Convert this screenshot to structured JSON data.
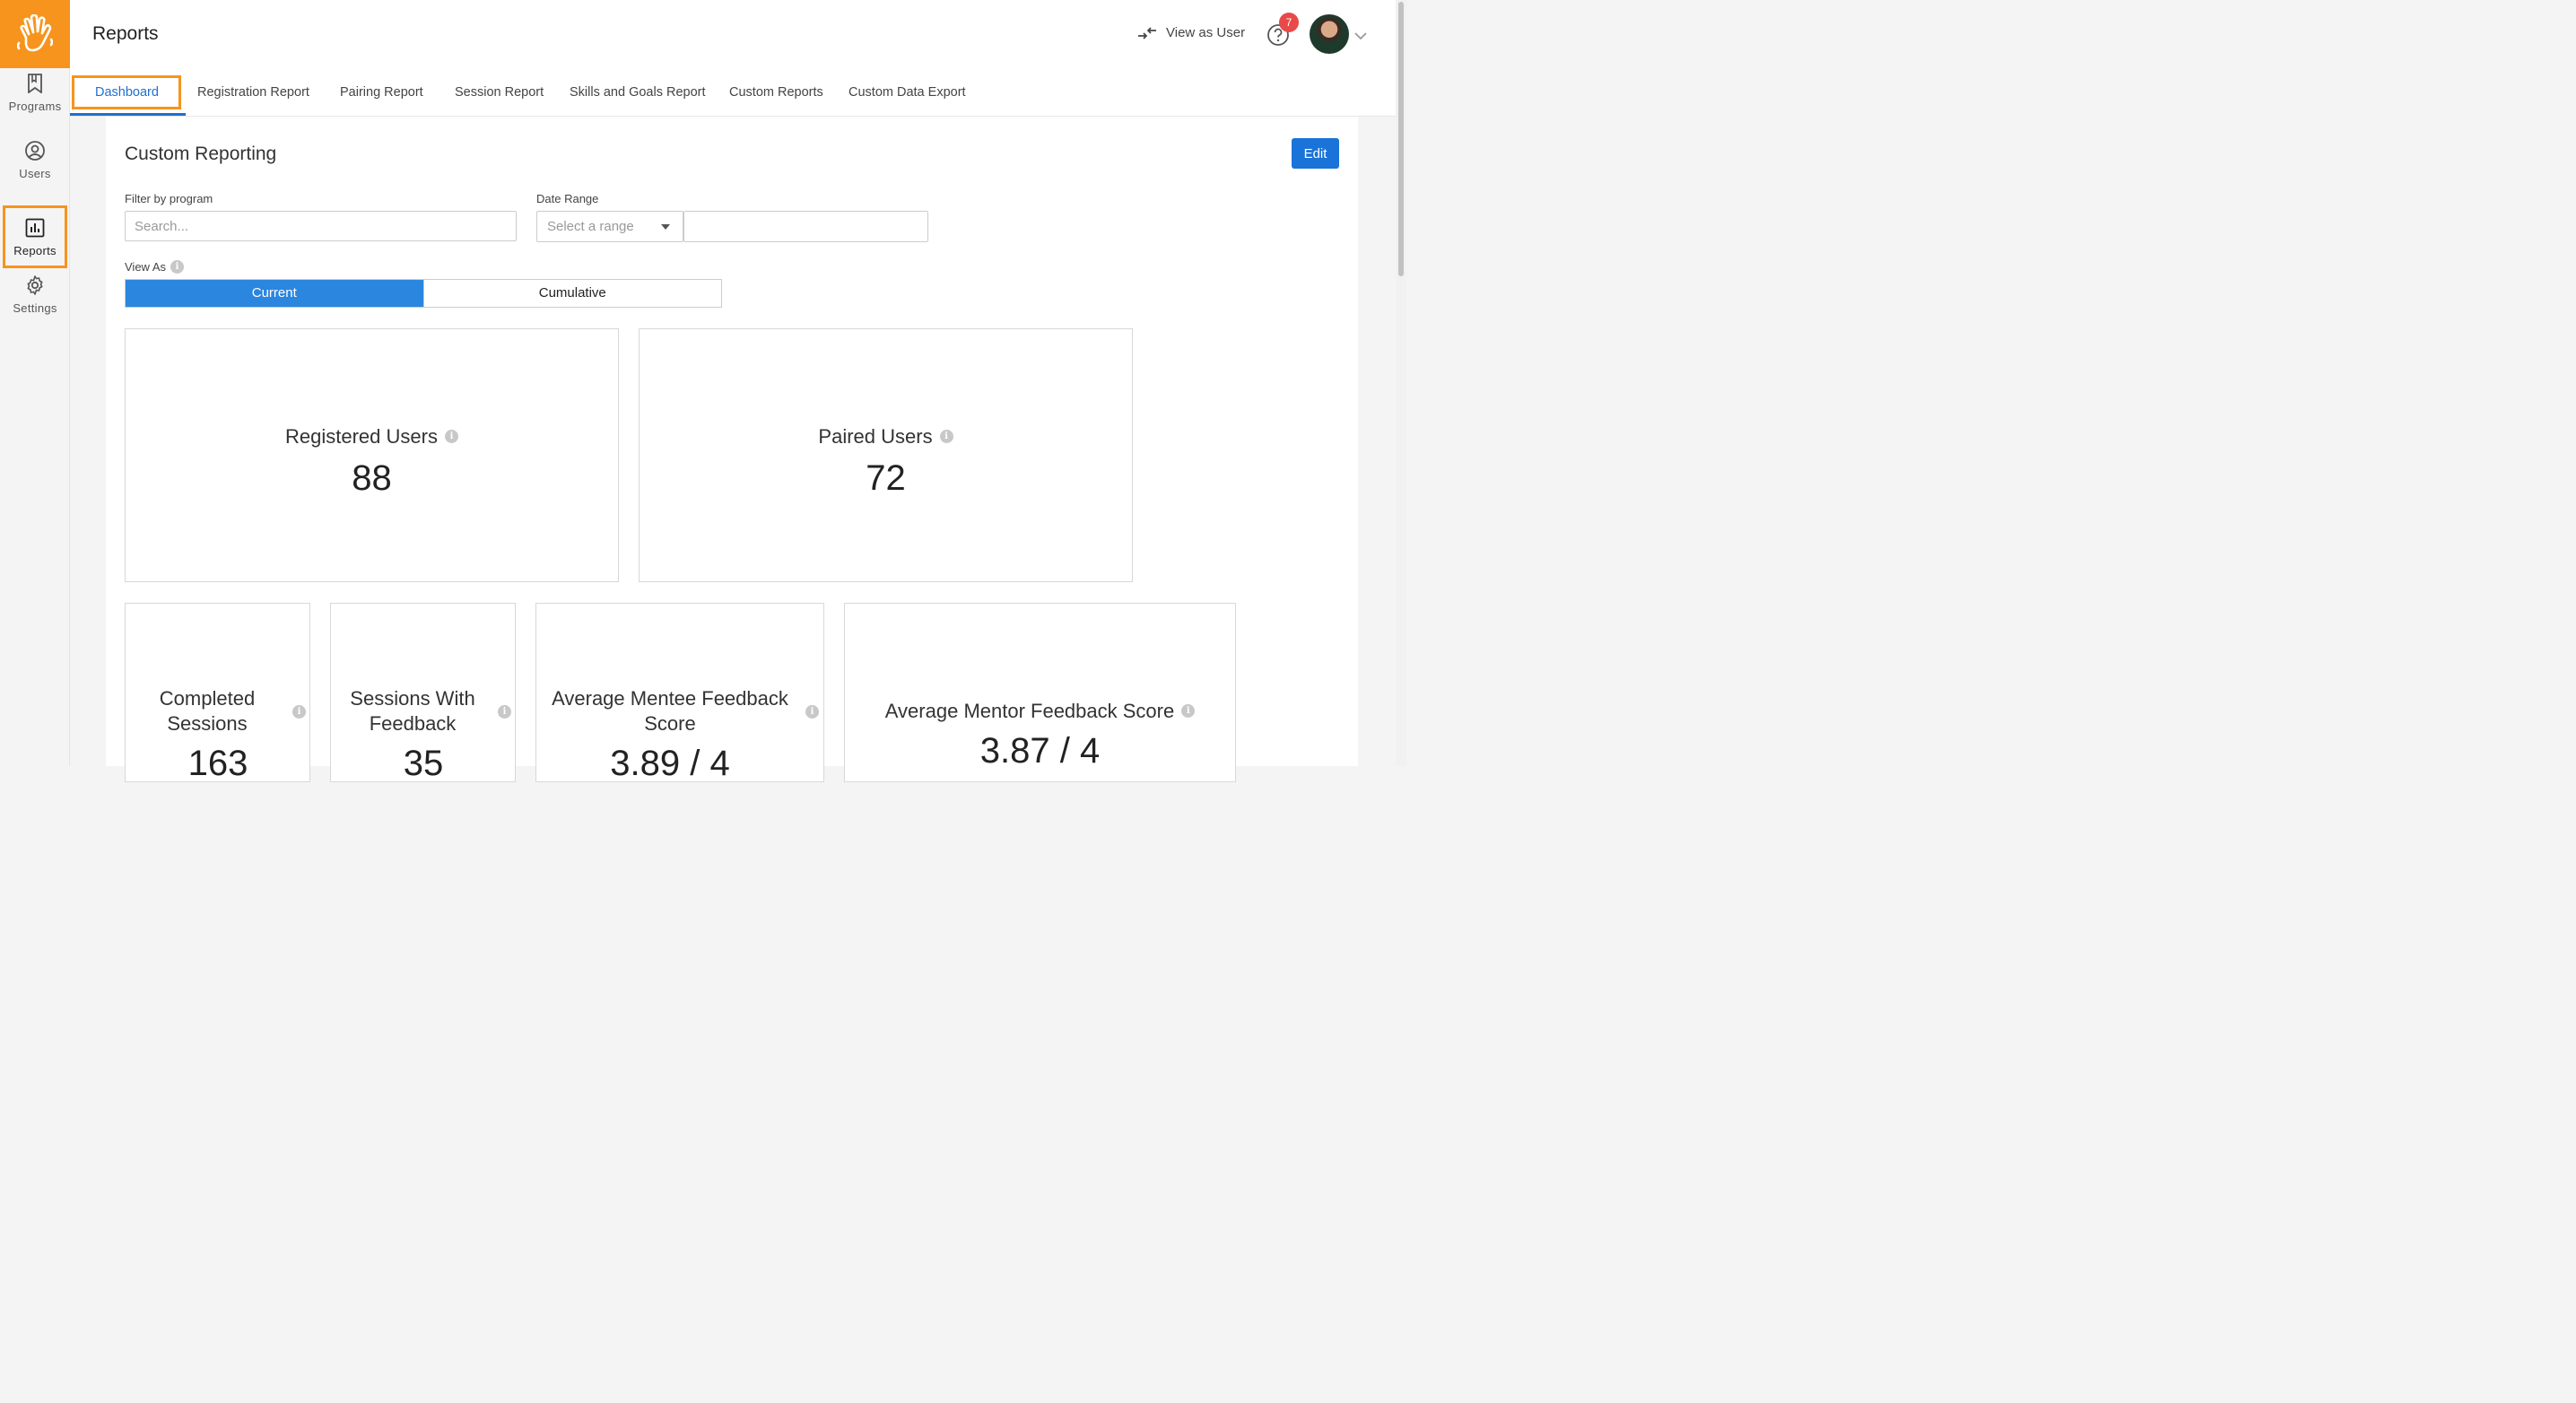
{
  "sidebar": {
    "logo": "hand-logo",
    "items": [
      {
        "label": "Programs",
        "icon": "bookmark-icon"
      },
      {
        "label": "Users",
        "icon": "user-circle-icon"
      },
      {
        "label": "Reports",
        "icon": "bar-chart-icon"
      },
      {
        "label": "Settings",
        "icon": "gear-icon"
      }
    ],
    "active": "Reports"
  },
  "header": {
    "title": "Reports",
    "view_as_user": "View as User",
    "help_badge": "7"
  },
  "tabs": [
    {
      "label": "Dashboard"
    },
    {
      "label": "Registration Report"
    },
    {
      "label": "Pairing Report"
    },
    {
      "label": "Session Report"
    },
    {
      "label": "Skills and Goals Report"
    },
    {
      "label": "Custom Reports"
    },
    {
      "label": "Custom Data Export"
    }
  ],
  "main": {
    "title": "Custom Reporting",
    "edit_label": "Edit",
    "filter_label": "Filter by program",
    "search_placeholder": "Search...",
    "date_range_label": "Date Range",
    "date_range_placeholder": "Select a range",
    "view_as_label": "View As",
    "view_as_options": [
      "Current",
      "Cumulative"
    ],
    "view_as_selected": "Current"
  },
  "cards": [
    {
      "title": "Registered Users",
      "value": "88"
    },
    {
      "title": "Paired Users",
      "value": "72"
    },
    {
      "title_lines": [
        "Completed",
        "Sessions"
      ],
      "value": "163"
    },
    {
      "title_lines": [
        "Sessions With",
        "Feedback"
      ],
      "value": "35"
    },
    {
      "title_lines": [
        "Average Mentee Feedback",
        "Score"
      ],
      "value": "3.89 / 4"
    },
    {
      "title": "Average Mentor Feedback Score",
      "value": "3.87 / 4"
    }
  ],
  "colors": {
    "brand": "#f7941d",
    "accent": "#1a73d8",
    "badge": "#e84a4a"
  }
}
